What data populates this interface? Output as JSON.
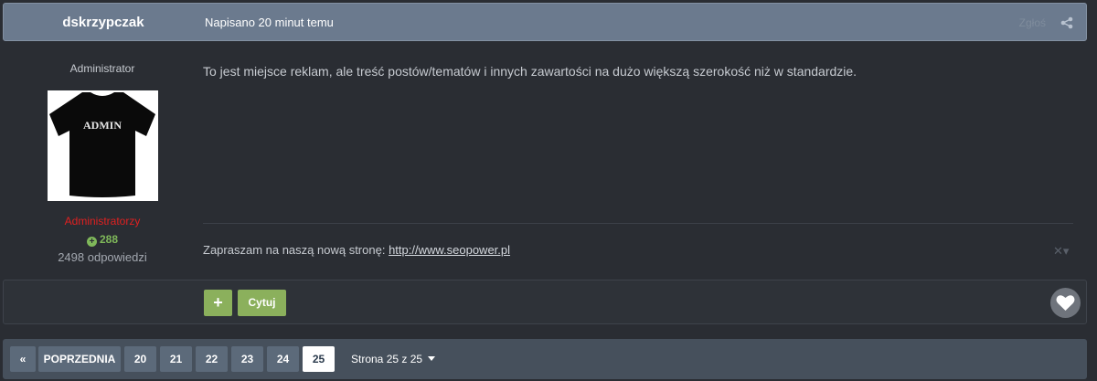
{
  "post": {
    "author": "dskrzypczak",
    "date": "Napisano 20 minut temu",
    "report": "Zgłoś",
    "body": "To jest miejsce reklam, ale treść postów/tematów i innych zawartości na dużo większą szerokość niż w standardzie."
  },
  "author_panel": {
    "title": "Administrator",
    "avatar_text": "ADMIN",
    "group": "Administratorzy",
    "reputation": "288",
    "post_count": "2498 odpowiedzi"
  },
  "signature": {
    "text": "Zapraszam na naszą nową stronę:",
    "link": "http://www.seopower.pl",
    "toggle": "✕▾"
  },
  "actions": {
    "plus_label": "+",
    "quote_label": "Cytuj"
  },
  "pagination": {
    "prev_arrow": "«",
    "prev_label": "POPRZEDNIA",
    "pages": [
      "20",
      "21",
      "22",
      "23",
      "24",
      "25"
    ],
    "active_page": "25",
    "info": "Strona 25 z 25"
  },
  "colors": {
    "header_bg": "#6b7a8e",
    "page_bg": "#2a2d33",
    "accent_green": "#8bb05c",
    "group_red": "#e02020",
    "reputation_green": "#7fb85a"
  }
}
